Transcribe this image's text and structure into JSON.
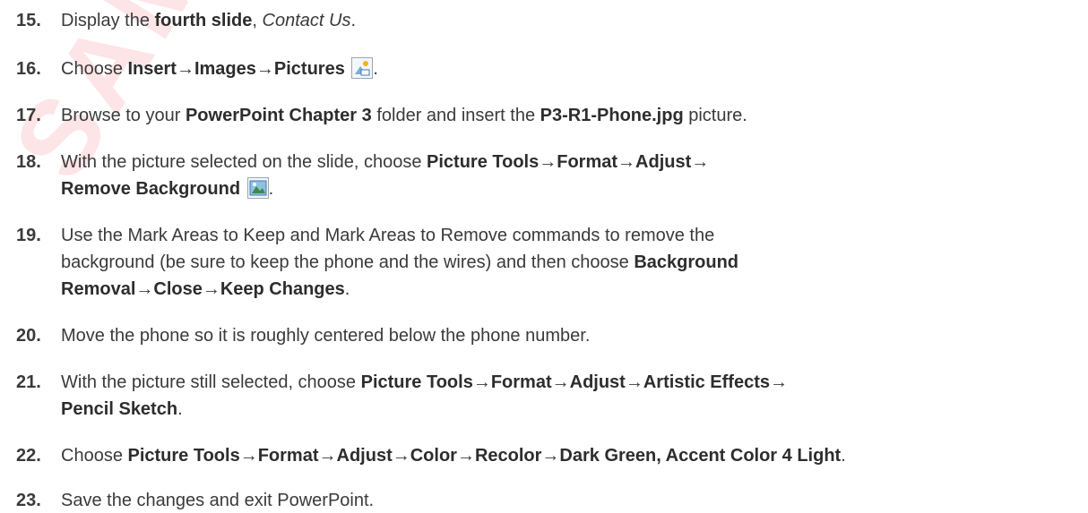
{
  "watermark": "SAMPLE",
  "steps": [
    {
      "number": "15.",
      "parts": [
        {
          "t": "Display the ",
          "s": "n"
        },
        {
          "t": "fourth slide",
          "s": "b"
        },
        {
          "t": ", ",
          "s": "n"
        },
        {
          "t": "Contact Us",
          "s": "i"
        },
        {
          "t": ".",
          "s": "n"
        }
      ]
    },
    {
      "number": "16.",
      "parts": [
        {
          "t": "Choose ",
          "s": "n"
        },
        {
          "t": "Insert",
          "s": "b"
        },
        {
          "t": "→",
          "s": "a"
        },
        {
          "t": "Images",
          "s": "b"
        },
        {
          "t": "→",
          "s": "a"
        },
        {
          "t": "Pictures",
          "s": "b"
        },
        {
          "t": " ",
          "s": "n"
        },
        {
          "icon": "pictures-icon"
        },
        {
          "t": ".",
          "s": "n"
        }
      ]
    },
    {
      "number": "17.",
      "parts": [
        {
          "t": "Browse to your ",
          "s": "n"
        },
        {
          "t": "PowerPoint Chapter 3",
          "s": "b"
        },
        {
          "t": " folder and insert the ",
          "s": "n"
        },
        {
          "t": "P3-R1-Phone.jpg",
          "s": "b"
        },
        {
          "t": " picture.",
          "s": "n"
        }
      ]
    },
    {
      "number": "18.",
      "parts": [
        {
          "t": "With the picture selected on the slide, choose ",
          "s": "n"
        },
        {
          "t": "Picture Tools",
          "s": "b"
        },
        {
          "t": "→",
          "s": "a"
        },
        {
          "t": "Format",
          "s": "b"
        },
        {
          "t": "→",
          "s": "a"
        },
        {
          "t": "Adjust",
          "s": "b"
        },
        {
          "t": "→",
          "s": "a"
        },
        {
          "br": true
        },
        {
          "t": "Remove Background",
          "s": "b"
        },
        {
          "t": " ",
          "s": "n"
        },
        {
          "icon": "remove-background-icon"
        },
        {
          "t": ".",
          "s": "n"
        }
      ]
    },
    {
      "number": "19.",
      "parts": [
        {
          "t": "Use the Mark Areas to Keep and Mark Areas to Remove commands to remove the",
          "s": "n"
        },
        {
          "br": true
        },
        {
          "t": "background (be sure to keep the phone and the wires) and then choose ",
          "s": "n"
        },
        {
          "t": "Background",
          "s": "b"
        },
        {
          "br": true
        },
        {
          "t": "Removal",
          "s": "b"
        },
        {
          "t": "→",
          "s": "a"
        },
        {
          "t": "Close",
          "s": "b"
        },
        {
          "t": "→",
          "s": "a"
        },
        {
          "t": "Keep Changes",
          "s": "b"
        },
        {
          "t": ".",
          "s": "n"
        }
      ]
    },
    {
      "number": "20.",
      "parts": [
        {
          "t": "Move the phone so it is roughly centered below the phone number.",
          "s": "n"
        }
      ]
    },
    {
      "number": "21.",
      "parts": [
        {
          "t": "With the picture still selected, choose ",
          "s": "n"
        },
        {
          "t": "Picture Tools",
          "s": "b"
        },
        {
          "t": "→",
          "s": "a"
        },
        {
          "t": "Format",
          "s": "b"
        },
        {
          "t": "→",
          "s": "a"
        },
        {
          "t": "Adjust",
          "s": "b"
        },
        {
          "t": "→",
          "s": "a"
        },
        {
          "t": "Artistic Effects",
          "s": "b"
        },
        {
          "t": "→",
          "s": "a"
        },
        {
          "br": true
        },
        {
          "t": "Pencil Sketch",
          "s": "b"
        },
        {
          "t": ".",
          "s": "n"
        }
      ]
    },
    {
      "number": "22.",
      "parts": [
        {
          "t": "Choose ",
          "s": "n"
        },
        {
          "t": "Picture Tools",
          "s": "b"
        },
        {
          "t": "→",
          "s": "a"
        },
        {
          "t": "Format",
          "s": "b"
        },
        {
          "t": "→",
          "s": "a"
        },
        {
          "t": "Adjust",
          "s": "b"
        },
        {
          "t": "→",
          "s": "a"
        },
        {
          "t": "Color",
          "s": "b"
        },
        {
          "t": "→",
          "s": "a"
        },
        {
          "t": "Recolor",
          "s": "b"
        },
        {
          "t": "→",
          "s": "a"
        },
        {
          "t": "Dark Green, Accent Color 4 Light",
          "s": "b"
        },
        {
          "t": ".",
          "s": "n"
        }
      ]
    },
    {
      "number": "23.",
      "parts": [
        {
          "t": "Save the changes and exit PowerPoint.",
          "s": "n"
        }
      ]
    }
  ],
  "colors": {
    "text": "#3a3a3a",
    "watermark": "#fde4e7",
    "icon_border": "#9aa8b8"
  }
}
